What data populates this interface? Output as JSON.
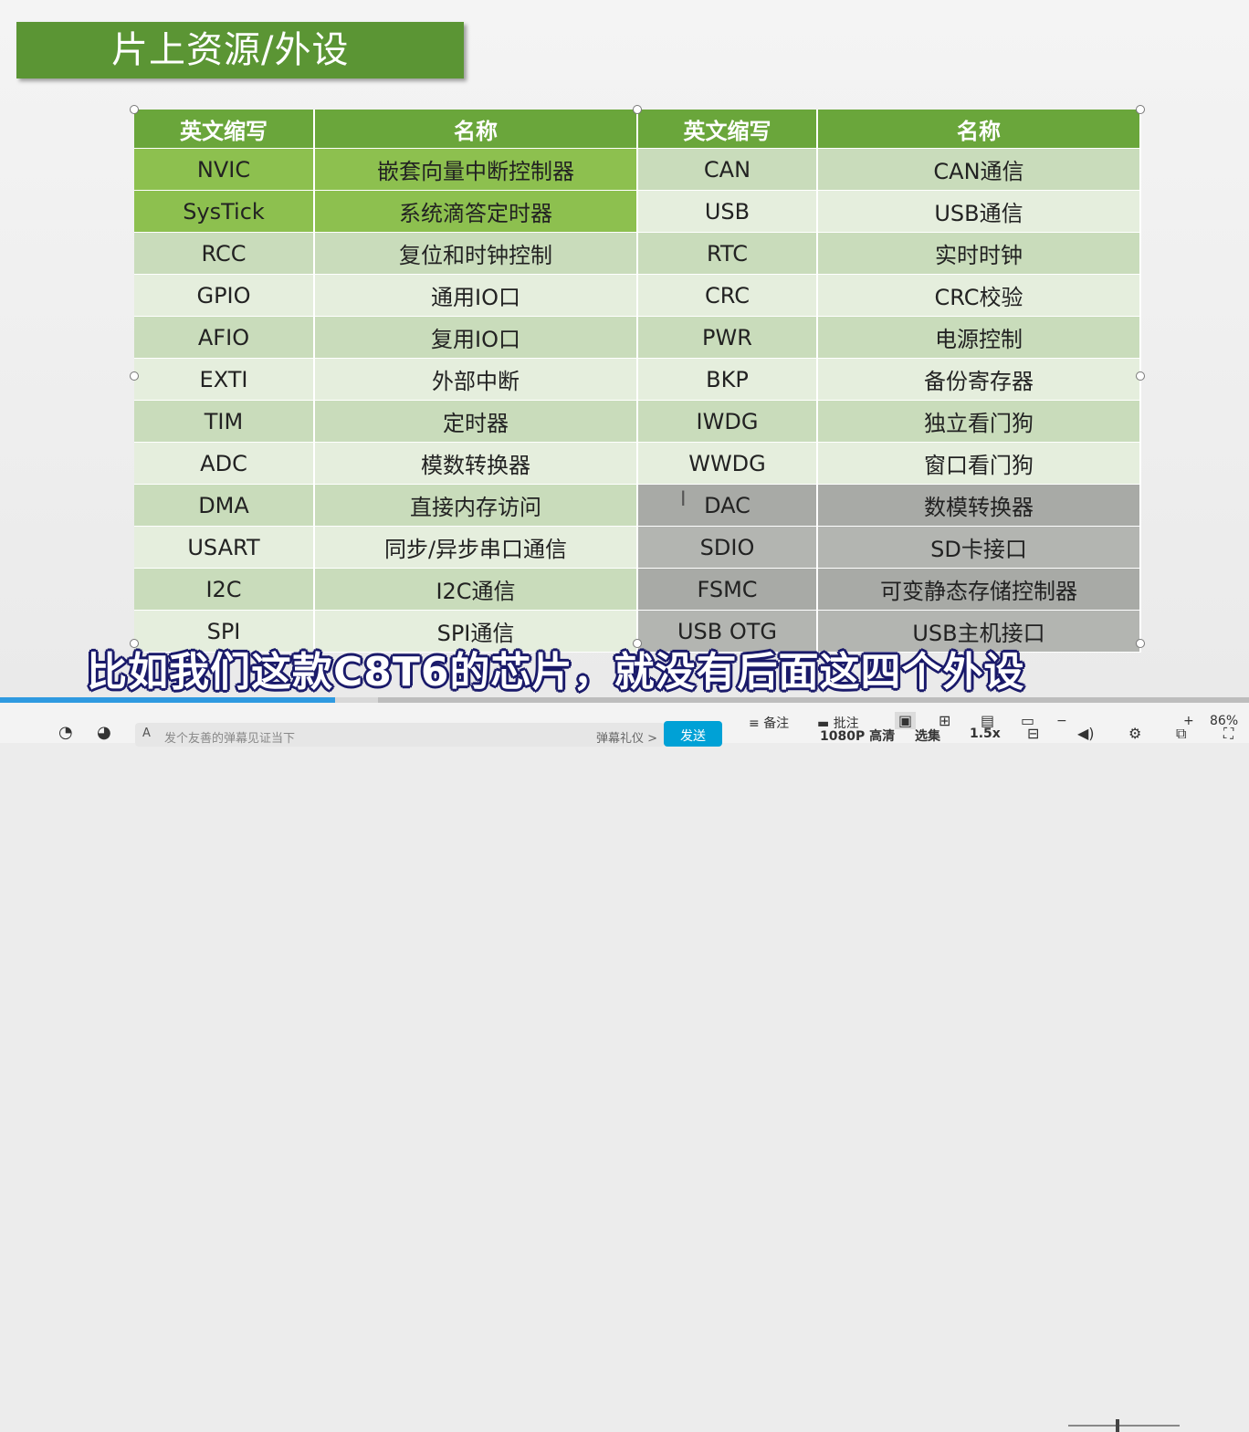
{
  "slide": {
    "title": "片上资源/外设",
    "headers": [
      "英文缩写",
      "名称",
      "英文缩写",
      "名称"
    ],
    "rows": [
      {
        "a1": "NVIC",
        "n1": "嵌套向量中断控制器",
        "a2": "CAN",
        "n2": "CAN通信"
      },
      {
        "a1": "SysTick",
        "n1": "系统滴答定时器",
        "a2": "USB",
        "n2": "USB通信"
      },
      {
        "a1": "RCC",
        "n1": "复位和时钟控制",
        "a2": "RTC",
        "n2": "实时时钟"
      },
      {
        "a1": "GPIO",
        "n1": "通用IO口",
        "a2": "CRC",
        "n2": "CRC校验"
      },
      {
        "a1": "AFIO",
        "n1": "复用IO口",
        "a2": "PWR",
        "n2": "电源控制"
      },
      {
        "a1": "EXTI",
        "n1": "外部中断",
        "a2": "BKP",
        "n2": "备份寄存器"
      },
      {
        "a1": "TIM",
        "n1": "定时器",
        "a2": "IWDG",
        "n2": "独立看门狗"
      },
      {
        "a1": "ADC",
        "n1": "模数转换器",
        "a2": "WWDG",
        "n2": "窗口看门狗"
      },
      {
        "a1": "DMA",
        "n1": "直接内存访问",
        "a2": "DAC",
        "n2": "数模转换器"
      },
      {
        "a1": "USART",
        "n1": "同步/异步串口通信",
        "a2": "SDIO",
        "n2": "SD卡接口"
      },
      {
        "a1": "I2C",
        "n1": "I2C通信",
        "a2": "FSMC",
        "n2": "可变静态存储控制器"
      },
      {
        "a1": "SPI",
        "n1": "SPI通信",
        "a2": "USB OTG",
        "n2": "USB主机接口"
      }
    ]
  },
  "subtitle": "比如我们这款C8T6的芯片，就没有后面这四个外设",
  "player": {
    "danmu_placeholder": "发个友善的弹幕见证当下",
    "danmu_etiquette": "弹幕礼仪 >",
    "send_label": "发送",
    "notes_label": "备注",
    "annotate_label": "批注",
    "quality_label": "1080P 高清",
    "episodes_label": "选集",
    "speed_label": "1.5x",
    "zoom_label": "86%",
    "progress": 0.268,
    "zoom_level": 0.43
  },
  "colors": {
    "title_green": "#5b9534",
    "header_green": "#6aa63b",
    "highlight_green": "#8dc04f",
    "row_light": "#e5eedd",
    "row_dark": "#c9dcbb",
    "gray_cell": "#b3b5b1",
    "progress_blue": "#2f9ae0"
  }
}
